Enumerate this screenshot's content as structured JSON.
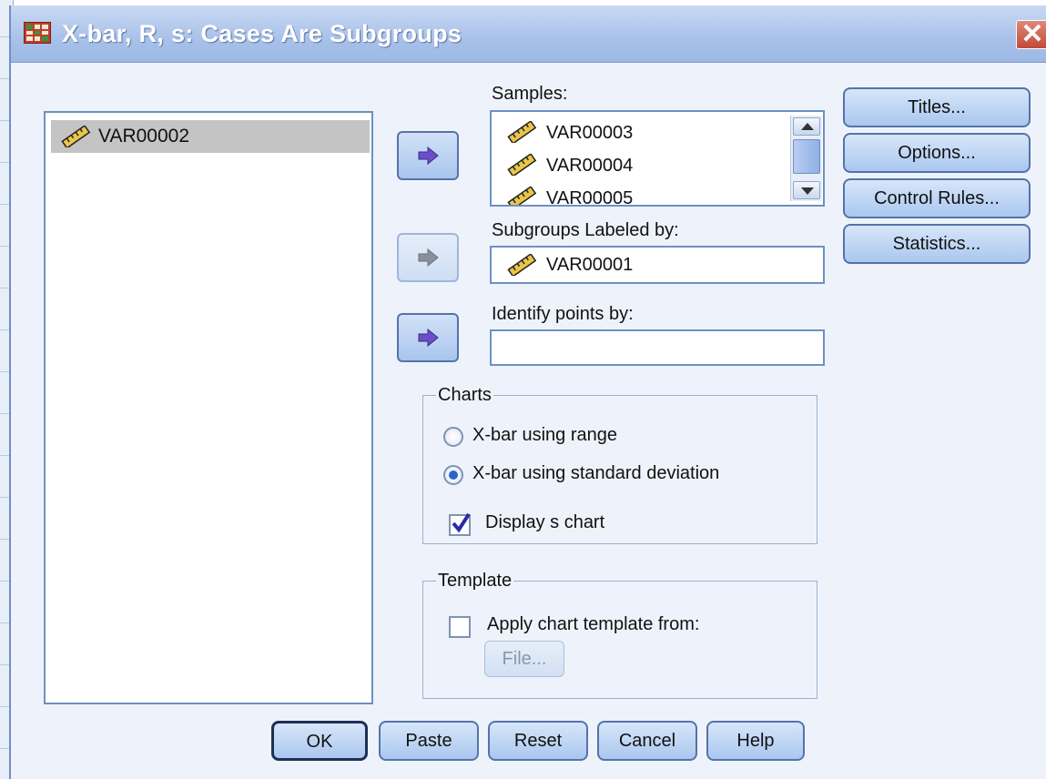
{
  "window": {
    "title": "X-bar, R, s: Cases Are Subgroups",
    "close_label": "✕"
  },
  "source_list": {
    "items": [
      {
        "label": "VAR00002",
        "icon": "ruler-icon",
        "selected": true
      }
    ]
  },
  "samples": {
    "label": "Samples:",
    "items": [
      "VAR00003",
      "VAR00004",
      "VAR00005"
    ]
  },
  "subgroups": {
    "label": "Subgroups Labeled by:",
    "value": "VAR00001"
  },
  "identify": {
    "label": "Identify points by:",
    "value": ""
  },
  "charts": {
    "legend": "Charts",
    "options": [
      {
        "label": "X-bar using range",
        "selected": false
      },
      {
        "label": "X-bar using standard deviation",
        "selected": true
      }
    ],
    "display_s_chart": {
      "label": "Display s chart",
      "checked": true
    }
  },
  "template": {
    "legend": "Template",
    "apply": {
      "label": "Apply chart template from:",
      "checked": false
    },
    "file_button": "File..."
  },
  "side_buttons": {
    "titles": "Titles...",
    "options": "Options...",
    "control_rules": "Control Rules...",
    "statistics": "Statistics..."
  },
  "bottom_buttons": {
    "ok": "OK",
    "paste": "Paste",
    "reset": "Reset",
    "cancel": "Cancel",
    "help": "Help"
  },
  "colors": {
    "titlebar": "#a8c1ea",
    "dialog_bg": "#eef3fb",
    "button_face": "#aac7ef",
    "arrow": "#6a4fc8",
    "selection": "#c4c4c4"
  }
}
